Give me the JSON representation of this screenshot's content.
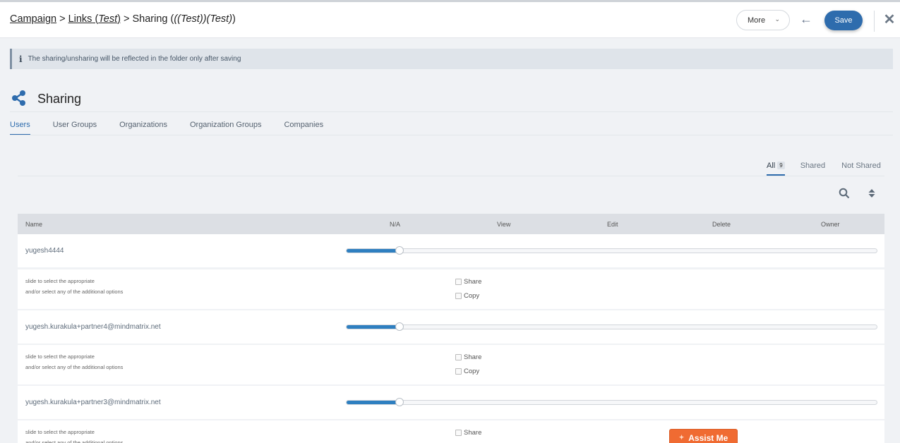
{
  "header": {
    "breadcrumb": {
      "campaign": "Campaign",
      "links": "Links",
      "links_tag": "Test",
      "sharing": "Sharing",
      "sharing_tag": "((Test))(Test)"
    },
    "more_label": "More",
    "save_label": "Save"
  },
  "info": {
    "message": "The sharing/unsharing will be reflected in the folder only after saving"
  },
  "page": {
    "title": "Sharing"
  },
  "tabs": [
    {
      "label": "Users",
      "active": true
    },
    {
      "label": "User Groups",
      "active": false
    },
    {
      "label": "Organizations",
      "active": false
    },
    {
      "label": "Organization Groups",
      "active": false
    },
    {
      "label": "Companies",
      "active": false
    }
  ],
  "filters": {
    "all": "All",
    "all_count": "9",
    "shared": "Shared",
    "not_shared": "Not Shared"
  },
  "table": {
    "columns": [
      "Name",
      "N/A",
      "View",
      "Edit",
      "Delete",
      "Owner"
    ],
    "hint_line1": "slide to select the appropriate",
    "hint_line2": "and/or select any of the additional options",
    "option_share": "Share",
    "option_copy": "Copy",
    "rows": [
      {
        "name": "yugesh4444",
        "level": 0.1
      },
      {
        "name": "yugesh.kurakula+partner4@mindmatrix.net",
        "level": 0.1
      },
      {
        "name": "yugesh.kurakula+partner3@mindmatrix.net",
        "level": 0.1
      }
    ]
  },
  "assist": {
    "label": "Assist Me"
  },
  "colors": {
    "accent": "#2e6cad",
    "slider": "#2e7fc0",
    "assist": "#f06b32"
  }
}
